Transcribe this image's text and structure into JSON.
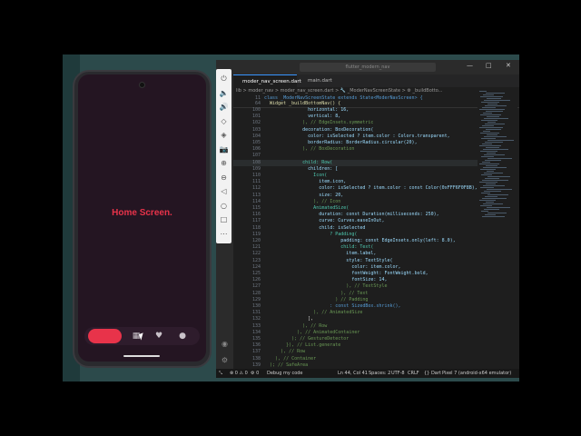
{
  "window": {
    "search_text": "flutter_modern_nav",
    "controls": [
      "—",
      "□",
      "✕"
    ]
  },
  "phone": {
    "home_text": "Home Screen.",
    "nav_icons": [
      "grid-icon",
      "heart-icon",
      "person-icon"
    ],
    "accent": "#e8334a"
  },
  "emulator_toolbar": {
    "buttons": [
      "⏻",
      "🔈",
      "🔊",
      "◇",
      "◈",
      "📷",
      "⊕",
      "⊖",
      "◁",
      "○",
      "□",
      "⋯"
    ]
  },
  "editor": {
    "tabs": [
      "moder_nav_screen.dart",
      "main.dart"
    ],
    "breadcrumb": "lib > moder_nav > moder_nav_screen.dart > 🔧 _ModerNavScreenState > ⚙ _buildBotto...",
    "sticky_lines": [
      {
        "num": "11",
        "text": "class _ModerNavScreenState extends State<ModerNavScreen> {"
      },
      {
        "num": "64",
        "text": "  Widget _buildBottomNav() {"
      }
    ],
    "lines": [
      {
        "num": "100",
        "text": "                horizontal: 16,"
      },
      {
        "num": "101",
        "text": "                vertical: 8,"
      },
      {
        "num": "102",
        "text": "              ), // EdgeInsets.symmetric"
      },
      {
        "num": "103",
        "text": "              decoration: BoxDecoration("
      },
      {
        "num": "104",
        "text": "                color: isSelected ? item.color : Colors.transparent,"
      },
      {
        "num": "105",
        "text": "                borderRadius: BorderRadius.circular(20),"
      },
      {
        "num": "106",
        "text": "              ), // BoxDecoration"
      },
      {
        "num": "107",
        "text": ""
      },
      {
        "num": "108",
        "text": "              child: Row("
      },
      {
        "num": "109",
        "text": "                children: ["
      },
      {
        "num": "110",
        "text": "                  Icon("
      },
      {
        "num": "111",
        "text": "                    item.icon,"
      },
      {
        "num": "112",
        "text": "                    color: isSelected ? item.color : const Color(0xFFF6F0F8B),"
      },
      {
        "num": "113",
        "text": "                    size: 20,"
      },
      {
        "num": "114",
        "text": "                  ), // Icon"
      },
      {
        "num": "115",
        "text": "                  AnimatedSize("
      },
      {
        "num": "116",
        "text": "                    duration: const Duration(milliseconds: 250),"
      },
      {
        "num": "117",
        "text": "                    curve: Curves.easeInOut,"
      },
      {
        "num": "118",
        "text": "                    child: isSelected"
      },
      {
        "num": "119",
        "text": "                        ? Padding("
      },
      {
        "num": "120",
        "text": "                            padding: const EdgeInsets.only(left: 8.0),"
      },
      {
        "num": "121",
        "text": "                            child: Text("
      },
      {
        "num": "122",
        "text": "                              item.label,"
      },
      {
        "num": "123",
        "text": "                              style: TextStyle("
      },
      {
        "num": "124",
        "text": "                                color: item.color,"
      },
      {
        "num": "125",
        "text": "                                fontWeight: FontWeight.bold,"
      },
      {
        "num": "126",
        "text": "                                fontSize: 14,"
      },
      {
        "num": "127",
        "text": "                              ), // TextStyle"
      },
      {
        "num": "128",
        "text": "                            ), // Text"
      },
      {
        "num": "129",
        "text": "                          ) // Padding"
      },
      {
        "num": "130",
        "text": "                        : const SizedBox.shrink(),"
      },
      {
        "num": "131",
        "text": "                  ), // AnimatedSize"
      },
      {
        "num": "132",
        "text": "                ],"
      },
      {
        "num": "133",
        "text": "              ), // Row"
      },
      {
        "num": "134",
        "text": "            ), // AnimatedContainer"
      },
      {
        "num": "135",
        "text": "          ); // GestureDetector"
      },
      {
        "num": "136",
        "text": "        }), // List.generate"
      },
      {
        "num": "137",
        "text": "      ), // Row"
      },
      {
        "num": "138",
        "text": "    ), // Container"
      },
      {
        "num": "139",
        "text": "  ); // SafeArea"
      }
    ]
  },
  "statusbar": {
    "errors": "⊗ 0 ⚠ 0",
    "warnings": "⚙ 0",
    "debug": "Debug my code",
    "position": "Ln 44, Col 41",
    "spaces": "Spaces: 2",
    "encoding": "UTF-8",
    "eol": "CRLF",
    "language": "{} Dart",
    "device": "Pixel 7 (android-x64 emulator)"
  }
}
